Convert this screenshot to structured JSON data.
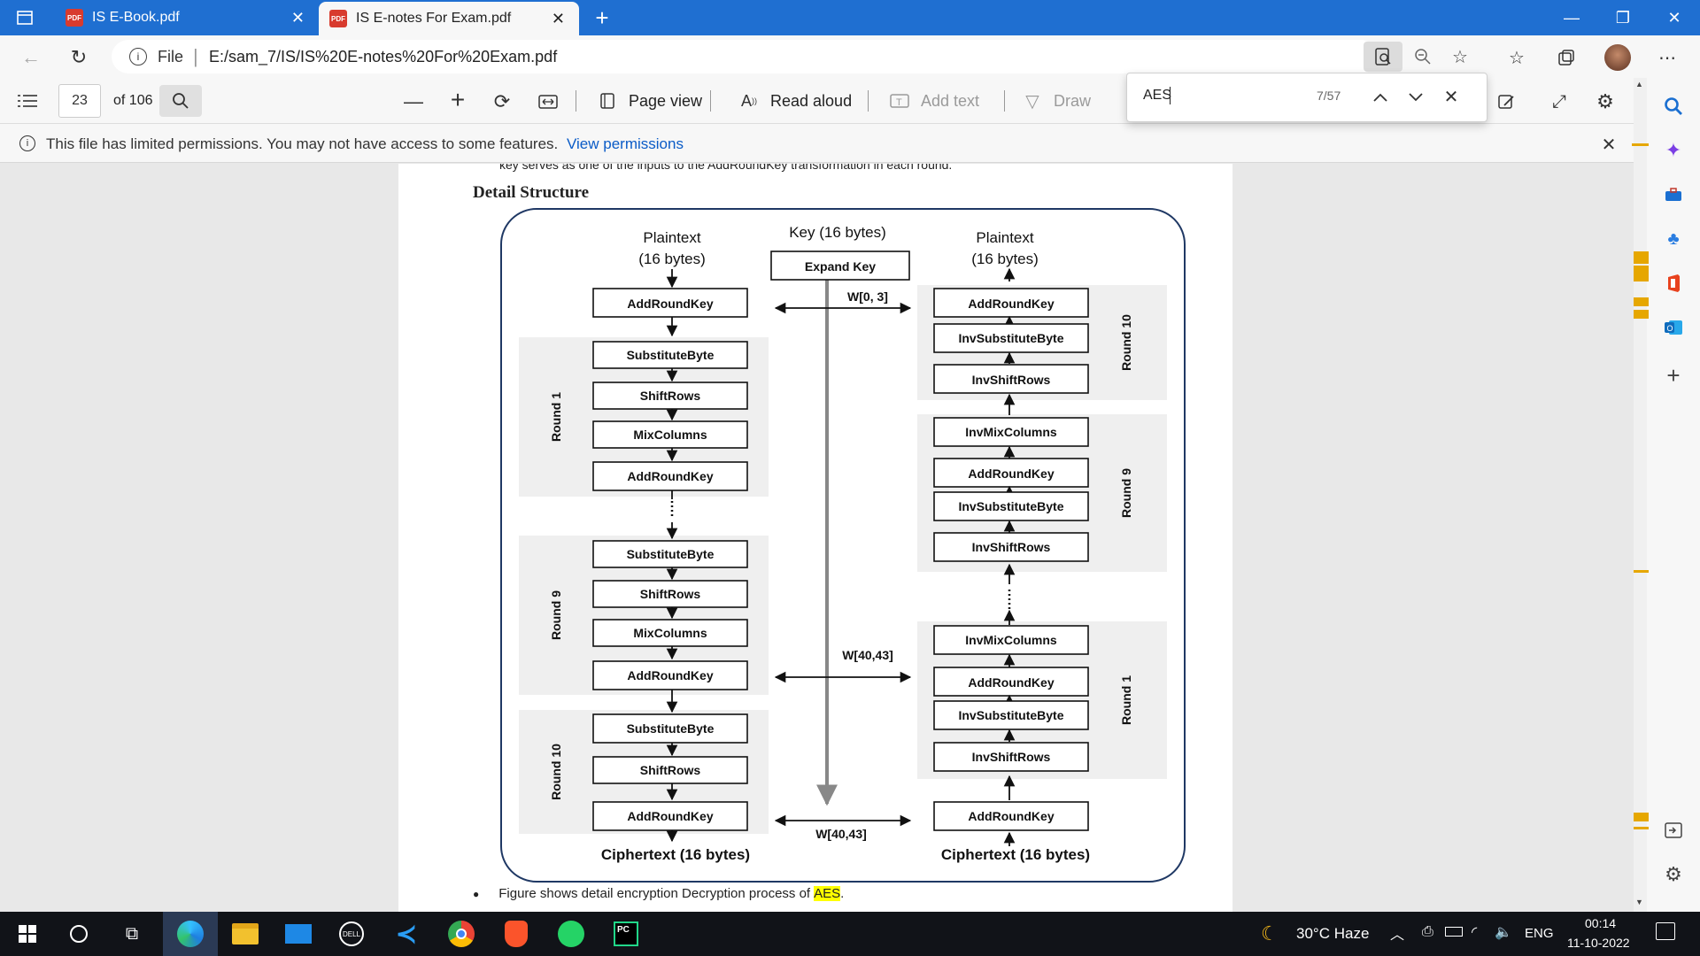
{
  "browser": {
    "tabs": [
      {
        "label": "IS E-Book.pdf",
        "icon": "pdf-icon"
      },
      {
        "label": "IS E-notes For Exam.pdf",
        "icon": "pdf-icon"
      }
    ],
    "url_prefix": "File",
    "url": "E:/sam_7/IS/IS%20E-notes%20For%20Exam.pdf"
  },
  "pdf_toolbar": {
    "page_number": "23",
    "page_total": "of 106",
    "page_view": "Page view",
    "read_aloud": "Read aloud",
    "add_text": "Add text",
    "draw": "Draw"
  },
  "find": {
    "query": "AES",
    "count": "7/57"
  },
  "infobar": {
    "message": "This file has limited permissions. You may not have access to some features.",
    "link": "View permissions"
  },
  "document": {
    "cut_line": "key serves as one of the inputs to the AddRoundKey transformation in each round.",
    "heading": "Detail Structure",
    "bullet_text": "Figure shows detail encryption Decryption process of ",
    "bullet_highlight": "AES",
    "bullet_end": "."
  },
  "diagram": {
    "enc_input": [
      "Plaintext",
      "(16 bytes)"
    ],
    "key_title": "Key (16 bytes)",
    "expand_key": "Expand Key",
    "dec_input": [
      "Plaintext",
      "(16 bytes)"
    ],
    "w_top": "W[0,  3]",
    "w_mid": "W[40,43]",
    "w_bot": "W[40,43]",
    "enc_output": "Ciphertext (16 bytes)",
    "dec_output": "Ciphertext (16 bytes)",
    "enc_initial": "AddRoundKey",
    "enc_round1": {
      "label": "Round 1",
      "steps": [
        "SubstituteByte",
        "ShiftRows",
        "MixColumns",
        "AddRoundKey"
      ]
    },
    "enc_round9": {
      "label": "Round 9",
      "steps": [
        "SubstituteByte",
        "ShiftRows",
        "MixColumns",
        "AddRoundKey"
      ]
    },
    "enc_round10": {
      "label": "Round 10",
      "steps": [
        "SubstituteByte",
        "ShiftRows",
        "AddRoundKey"
      ]
    },
    "dec_round10": {
      "label": "Round 10",
      "steps": [
        "AddRoundKey",
        "InvSubstituteByte",
        "InvShiftRows"
      ]
    },
    "dec_round9": {
      "label": "Round 9",
      "steps": [
        "InvMixColumns",
        "AddRoundKey",
        "InvSubstituteByte",
        "InvShiftRows"
      ]
    },
    "dec_round1": {
      "label": "Round 1",
      "steps": [
        "InvMixColumns",
        "AddRoundKey",
        "InvSubstituteByte",
        "InvShiftRows"
      ]
    },
    "dec_final": "AddRoundKey"
  },
  "taskbar": {
    "weather": "30°C  Haze",
    "lang": "ENG",
    "time": "00:14",
    "date": "11-10-2022",
    "apps": [
      "start-icon",
      "search-circle-icon",
      "task-view-icon",
      "edge-icon",
      "file-explorer-icon",
      "mail-icon",
      "dell-icon",
      "vscode-icon",
      "chrome-icon",
      "brave-icon",
      "whatsapp-icon",
      "pycharm-icon"
    ]
  },
  "colors": {
    "tabbar": "#1f6fd1",
    "link": "#0b5cc7",
    "highlight": "#ffff00",
    "scroll_mark": "#e6a700",
    "diagram_border": "#1f3864"
  }
}
